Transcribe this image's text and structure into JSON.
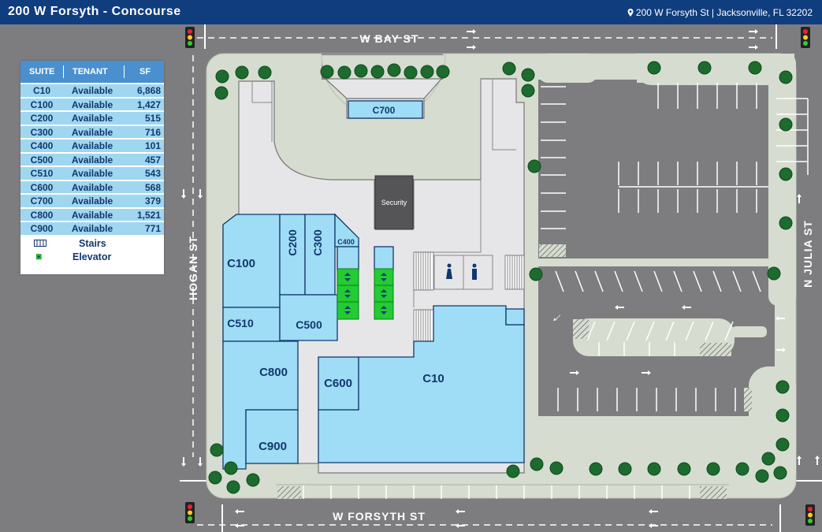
{
  "header": {
    "title": "200 W Forsyth - Concourse",
    "address": "200 W Forsyth St | Jacksonville, FL 32202"
  },
  "legend": {
    "columns": [
      "SUITE",
      "TENANT",
      "SF"
    ],
    "rows": [
      {
        "suite": "C10",
        "tenant": "Available",
        "sf": "6,868"
      },
      {
        "suite": "C100",
        "tenant": "Available",
        "sf": "1,427"
      },
      {
        "suite": "C200",
        "tenant": "Available",
        "sf": "515"
      },
      {
        "suite": "C300",
        "tenant": "Available",
        "sf": "716"
      },
      {
        "suite": "C400",
        "tenant": "Available",
        "sf": "101"
      },
      {
        "suite": "C500",
        "tenant": "Available",
        "sf": "457"
      },
      {
        "suite": "C510",
        "tenant": "Available",
        "sf": "543"
      },
      {
        "suite": "C600",
        "tenant": "Available",
        "sf": "568"
      },
      {
        "suite": "C700",
        "tenant": "Available",
        "sf": "379"
      },
      {
        "suite": "C800",
        "tenant": "Available",
        "sf": "1,521"
      },
      {
        "suite": "C900",
        "tenant": "Available",
        "sf": "771"
      }
    ],
    "stairs_label": "Stairs",
    "elevator_label": "Elevator"
  },
  "streets": {
    "north": "W BAY ST",
    "south": "W FORSYTH ST",
    "west": "HOGAN ST",
    "east": "N JULIA ST"
  },
  "suites": {
    "c10": "C10",
    "c100": "C100",
    "c200": "C200",
    "c300": "C300",
    "c400": "C400",
    "c500": "C500",
    "c510": "C510",
    "c600": "C600",
    "c700": "C700",
    "c800": "C800",
    "c900": "C900"
  },
  "security_label": "Security",
  "colors": {
    "header": "#0f3d7e",
    "suite_fill": "#9fdcf5",
    "suite_stroke": "#11386e",
    "elevator": "#22cc33",
    "road": "#7d7d7f",
    "sidewalk": "#d6ddd0",
    "tree": "#1d6b2e"
  }
}
